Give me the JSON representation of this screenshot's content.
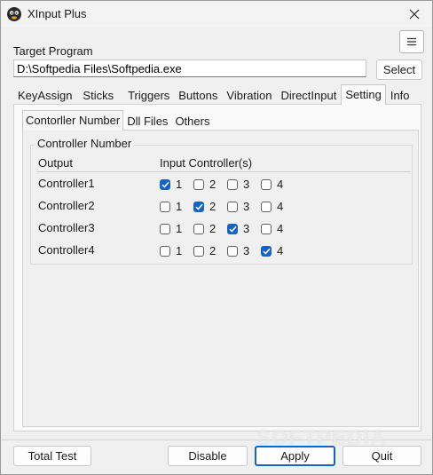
{
  "window": {
    "title": "XInput Plus",
    "close_icon": "close-icon"
  },
  "target": {
    "label": "Target Program",
    "path_value": "D:\\Softpedia Files\\Softpedia.exe",
    "select_label": "Select",
    "menu_icon": "hamburger-menu-icon"
  },
  "main_tabs": [
    {
      "label": "KeyAssign",
      "active": false
    },
    {
      "label": "Sticks",
      "active": false
    },
    {
      "label": "Triggers",
      "active": false
    },
    {
      "label": "Buttons",
      "active": false
    },
    {
      "label": "Vibration",
      "active": false
    },
    {
      "label": "DirectInput",
      "active": false
    },
    {
      "label": "Setting",
      "active": true
    },
    {
      "label": "Info",
      "active": false
    }
  ],
  "sub_tabs": [
    {
      "label": "Contorller Number",
      "active": true
    },
    {
      "label": "Dll Files",
      "active": false
    },
    {
      "label": "Others",
      "active": false
    }
  ],
  "controller_number": {
    "group_title": "Controller Number",
    "col_output": "Output",
    "col_input": "Input Controller(s)",
    "rows": [
      {
        "label": "Controller1",
        "options": [
          "1",
          "2",
          "3",
          "4"
        ],
        "checked": [
          true,
          false,
          false,
          false
        ]
      },
      {
        "label": "Controller2",
        "options": [
          "1",
          "2",
          "3",
          "4"
        ],
        "checked": [
          false,
          true,
          false,
          false
        ]
      },
      {
        "label": "Controller3",
        "options": [
          "1",
          "2",
          "3",
          "4"
        ],
        "checked": [
          false,
          false,
          true,
          false
        ]
      },
      {
        "label": "Controller4",
        "options": [
          "1",
          "2",
          "3",
          "4"
        ],
        "checked": [
          false,
          false,
          false,
          true
        ]
      }
    ]
  },
  "buttons": {
    "total_test": "Total Test",
    "disable": "Disable",
    "apply": "Apply",
    "quit": "Quit"
  },
  "watermark": "SOFTPEDIA",
  "colors": {
    "accent": "#1764c0",
    "background": "#f0f0f0"
  }
}
